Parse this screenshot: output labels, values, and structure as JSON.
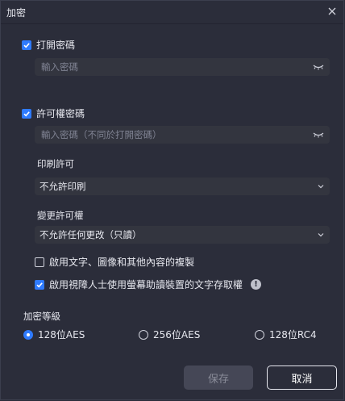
{
  "dialog": {
    "title": "加密"
  },
  "open_password": {
    "checkbox_label": "打開密碼",
    "checked": true,
    "placeholder": "輸入密碼"
  },
  "permission_password": {
    "checkbox_label": "許可權密碼",
    "checked": true,
    "placeholder": "輸入密碼（不同於打開密碼）",
    "print_label": "印刷許可",
    "print_value": "不允許印刷",
    "change_label": "變更許可權",
    "change_value": "不允許任何更改（只讀）",
    "copy_option": {
      "label": "啟用文字、圖像和其他內容的複製",
      "checked": false
    },
    "accessibility_option": {
      "label": "啟用視障人士使用螢幕助讀裝置的文字存取權",
      "checked": true
    }
  },
  "encryption_level": {
    "label": "加密等級",
    "options": [
      {
        "label": "128位AES",
        "selected": true
      },
      {
        "label": "256位AES",
        "selected": false
      },
      {
        "label": "128位RC4",
        "selected": false
      }
    ]
  },
  "buttons": {
    "save": "保存",
    "cancel": "取消"
  },
  "colors": {
    "accent": "#2f7bff",
    "background": "#2b2d3a",
    "field": "#33353f"
  }
}
